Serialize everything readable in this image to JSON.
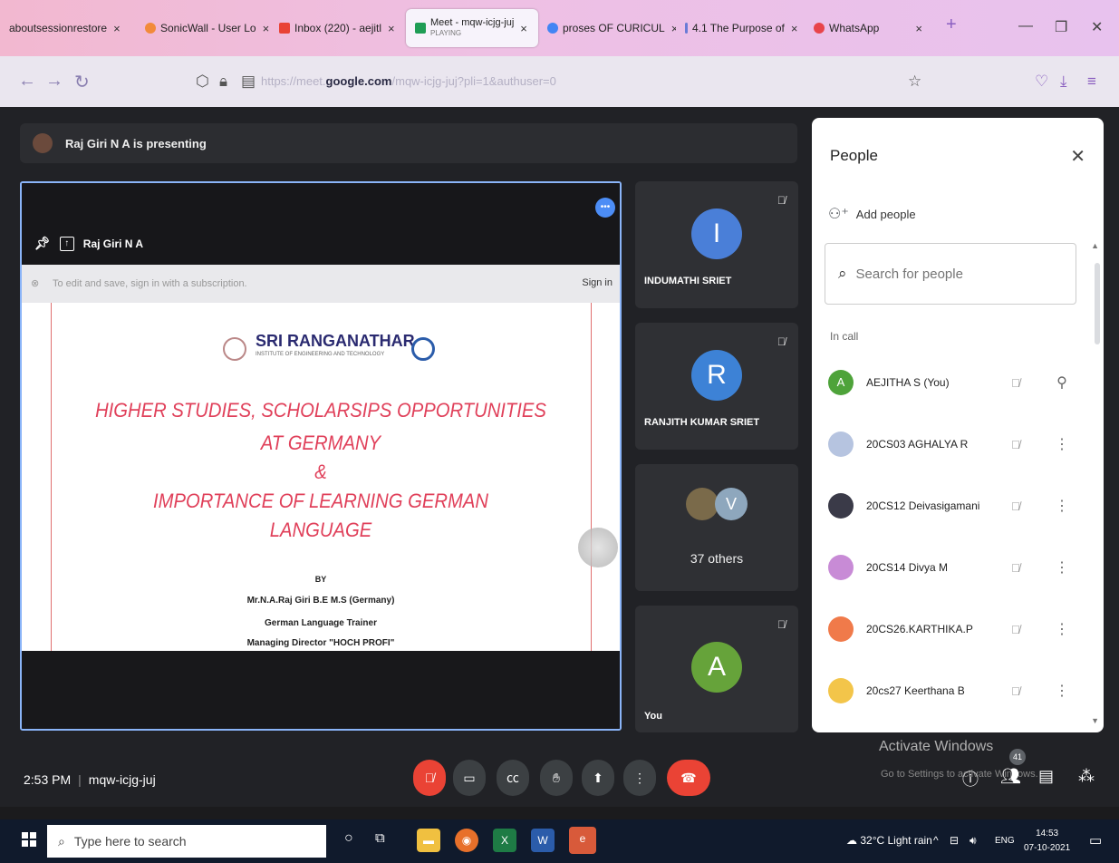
{
  "browser": {
    "tabs": [
      {
        "label": "aboutsessionrestore",
        "icon": "restore-icon"
      },
      {
        "label": "SonicWall - User Lo",
        "icon": "sonicwall-icon"
      },
      {
        "label": "Inbox (220) - aejitl",
        "icon": "gmail-icon"
      },
      {
        "label": "Meet - mqw-icjg-juj",
        "sublabel": "PLAYING",
        "icon": "meet-icon",
        "active": true
      },
      {
        "label": "proses OF CURICUL",
        "icon": "google-icon"
      },
      {
        "label": "4.1 The Purpose of",
        "icon": "doc-icon"
      },
      {
        "label": "WhatsApp",
        "icon": "whatsapp-icon"
      }
    ],
    "new_tab": "+",
    "url_prefix": "https://meet.",
    "url_domain": "google.com",
    "url_suffix": "/mqw-icjg-juj?pli=1&authuser=0"
  },
  "meet": {
    "presenting_text": "Raj Giri N A is presenting",
    "signin_bar": {
      "message": "To edit and save, sign in with a subscription.",
      "sign_in": "Sign in"
    },
    "slide": {
      "institute": "SRI RANGANATHAR",
      "institute_sub": "INSTITUTE OF ENGINEERING AND TECHNOLOGY",
      "headline_lines": [
        "HIGHER STUDIES, SCHOLARSIPS OPPORTUNITIES",
        "AT GERMANY",
        "&",
        "IMPORTANCE OF LEARNING GERMAN",
        "LANGUAGE"
      ],
      "by": "BY",
      "author": "Mr.N.A.Raj Giri B.E M.S (Germany)",
      "role": "German Language Trainer",
      "role2": "Managing Director \"HOCH PROFI\""
    },
    "presenter_name": "Raj Giri N A",
    "tiles": [
      {
        "initial": "I",
        "name": "INDUMATHI SRIET",
        "color": "#4a7fd8"
      },
      {
        "initial": "R",
        "name": "RANJITH KUMAR SRIET",
        "color": "#3d82d6"
      },
      {
        "initial": "V",
        "name": "37 others",
        "color": "#8ea7bd"
      },
      {
        "initial": "A",
        "name": "You",
        "color": "#66a33a"
      }
    ],
    "time": "2:53 PM",
    "meeting_code": "mqw-icjg-juj",
    "participant_count": "41"
  },
  "people_panel": {
    "title": "People",
    "add_people": "Add people",
    "search_placeholder": "Search for people",
    "in_call": "In call",
    "participants": [
      {
        "name": "AEJITHA S (You)",
        "initial": "A",
        "color": "#4ea33a"
      },
      {
        "name": "20CS03 AGHALYA R",
        "initial": "",
        "color": "#b6c4e0"
      },
      {
        "name": "20CS12 Deivasigamani",
        "initial": "",
        "color": "#3a3a48"
      },
      {
        "name": "20CS14 Divya M",
        "initial": "",
        "color": "#c88bd6"
      },
      {
        "name": "20CS26.KARTHIKA.P",
        "initial": "",
        "color": "#f07a4a"
      },
      {
        "name": "20cs27 Keerthana B",
        "initial": "",
        "color": "#f3c54a"
      }
    ]
  },
  "windows": {
    "activate_title": "Activate Windows",
    "activate_sub": "Go to Settings to activate Windows.",
    "search_placeholder": "Type here to search",
    "weather": "32°C  Light rain",
    "lang": "ENG",
    "clock_time": "14:53",
    "clock_date": "07-10-2021"
  }
}
